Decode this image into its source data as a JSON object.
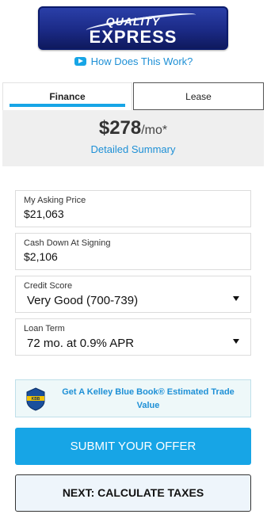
{
  "logo": {
    "line1": "QUALITY",
    "line2": "EXPRESS"
  },
  "how_link": "How Does This Work?",
  "tabs": [
    {
      "label": "Finance",
      "active": true
    },
    {
      "label": "Lease",
      "active": false
    }
  ],
  "payment": {
    "amount": "$278",
    "per": "/mo*",
    "summary_link": "Detailed Summary"
  },
  "fields": {
    "asking_price": {
      "label": "My Asking Price",
      "value": "$21,063"
    },
    "cash_down": {
      "label": "Cash Down At Signing",
      "value": "$2,106"
    },
    "credit_score": {
      "label": "Credit Score",
      "value": "Very Good (700-739)"
    },
    "loan_term": {
      "label": "Loan Term",
      "value": "72 mo. at 0.9% APR"
    }
  },
  "kbb": {
    "text": "Get A Kelley Blue Book® Estimated Trade Value",
    "badge_text": "KBB"
  },
  "buttons": {
    "submit": "SUBMIT YOUR OFFER",
    "next": "NEXT: CALCULATE TAXES"
  },
  "colors": {
    "accent": "#17a5e6",
    "link": "#1e90d6",
    "logo": "#1b2a86"
  }
}
